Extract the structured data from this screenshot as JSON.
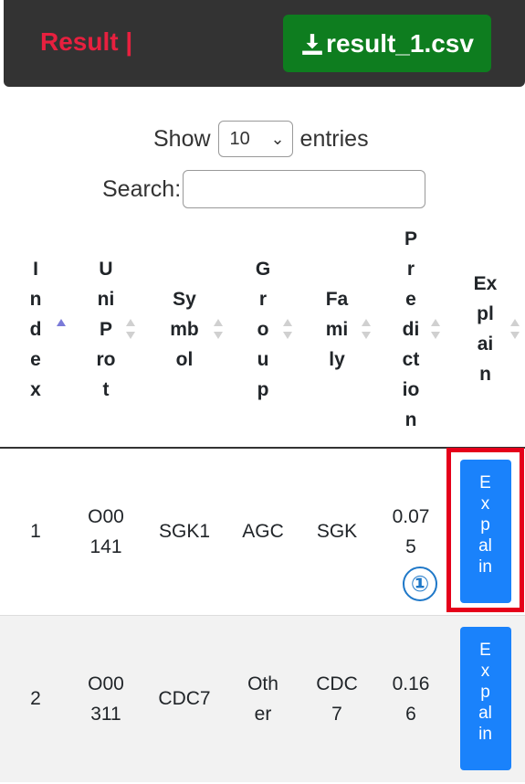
{
  "header": {
    "title": "Result |",
    "download_label": "result_1.csv"
  },
  "controls": {
    "show_label": "Show",
    "entries_value": "10",
    "entries_label": "entries",
    "search_label": "Search:",
    "search_value": ""
  },
  "table": {
    "columns": [
      "I\nn\nd\ne\nx",
      "U\nni\nP\nro\nt",
      "Sy\nmb\nol",
      "G\nr\no\nu\np",
      "Fa\nmi\nly",
      "P\nr\ne\ndi\nct\nio\nn",
      "Ex\npl\nai\nn"
    ],
    "rows": [
      {
        "index": "1",
        "uniprot": "O00\n141",
        "symbol": "SGK1",
        "group": "AGC",
        "family": "SGK",
        "prediction": "0.07\n5",
        "explain": "E\nx\np\nal\nin"
      },
      {
        "index": "2",
        "uniprot": "O00\n311",
        "symbol": "CDC7",
        "group": "Oth\ner",
        "family": "CDC\n7",
        "prediction": "0.16\n6",
        "explain": "E\nx\np\nal\nin"
      }
    ]
  },
  "annotation": {
    "marker": "①",
    "highlight_color": "#e5001a"
  },
  "colors": {
    "title": "#e8203f",
    "download_button": "#0e7d1f",
    "explain_button": "#1a82fb",
    "header_bar": "#333333"
  }
}
